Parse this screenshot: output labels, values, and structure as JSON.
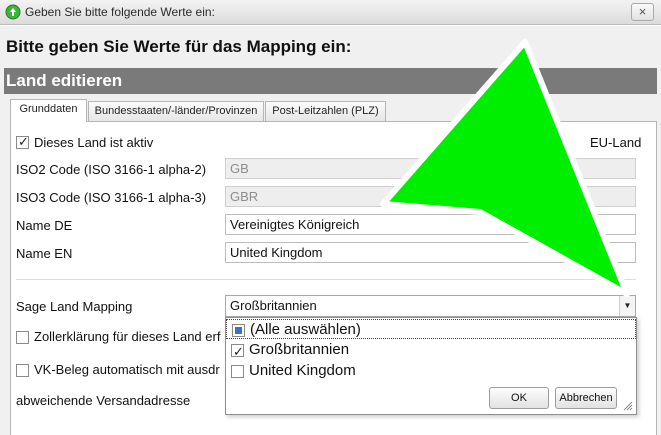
{
  "window": {
    "title": "Geben Sie bitte folgende Werte ein:",
    "close_label": "×"
  },
  "heading": "Bitte geben Sie Werte für das Mapping ein:",
  "section": "Land editieren",
  "tabs": [
    "Grunddaten",
    "Bundesstaaten/-länder/Provinzen",
    "Post-Leitzahlen (PLZ)"
  ],
  "form": {
    "active": {
      "label": "Dieses Land ist aktiv",
      "checked": true
    },
    "eu": {
      "label": "EU-Land"
    },
    "iso2": {
      "label": "ISO2 Code (ISO 3166-1 alpha-2)",
      "value": "GB"
    },
    "iso3": {
      "label": "ISO3 Code (ISO 3166-1 alpha-3)",
      "value": "GBR"
    },
    "name_de": {
      "label": "Name DE",
      "value": "Vereinigtes Königreich"
    },
    "name_en": {
      "label": "Name EN",
      "value": "United Kingdom"
    },
    "sage": {
      "label": "Sage Land Mapping",
      "value": "Großbritannien"
    },
    "zoll": {
      "label": "Zollerklärung für dieses Land erf"
    },
    "vk": {
      "label": "VK-Beleg automatisch mit ausdr"
    },
    "versand": {
      "label": "abweichende Versandadresse"
    }
  },
  "dropdown": {
    "options": [
      {
        "label": "(Alle auswählen)",
        "checked": false,
        "partial": true
      },
      {
        "label": "Großbritannien",
        "checked": true
      },
      {
        "label": "United Kingdom",
        "checked": false
      }
    ],
    "ok": "OK",
    "cancel": "Abbrechen"
  },
  "icons": {
    "app": "green-recycle-icon",
    "checkmark": "✓",
    "dropdown": "▼",
    "overlay": "green-arrow-pointer"
  },
  "colors": {
    "section_bar": "#7a7a7a",
    "overlay_arrow": "#00ee00"
  }
}
